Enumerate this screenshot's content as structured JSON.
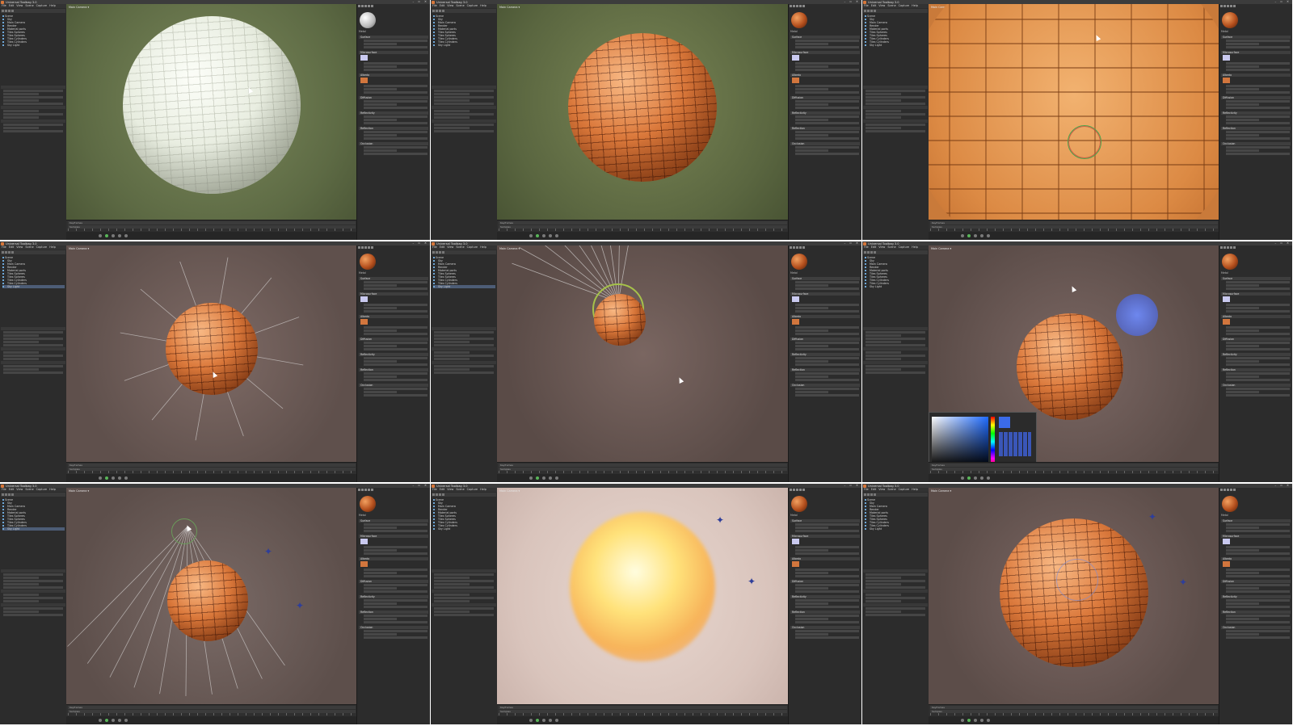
{
  "app": {
    "window_title": "Universal Toolbag 3.0",
    "menu": [
      "File",
      "Edit",
      "View",
      "Scene",
      "Capture",
      "Help"
    ],
    "viewport_label": "Main Camera ▾",
    "window_controls": "– ▫ ✕"
  },
  "scene_tree": [
    "Scene",
    "Sky",
    "Main Camera",
    "Render",
    "Material ports",
    "Tiles Spheres",
    "Tiles Spheres",
    "Tiles Cylinders",
    "Tiles Cylinders",
    "Sky Light"
  ],
  "material": {
    "name": "Metal",
    "sections": [
      "Surface",
      "Microsurface",
      "Albedo",
      "Diffusion",
      "Reflectivity",
      "Reflection",
      "Occlusion"
    ]
  },
  "timeline": {
    "row_labels": [
      "Keyframes",
      "Samples"
    ]
  },
  "colors": {
    "bg_dark": "#2a2a2a",
    "panel": "#2c2c2c",
    "accent_orange": "#d2763d",
    "select_blue": "#4d5d76"
  },
  "tiles": [
    {
      "kind": "white-sphere"
    },
    {
      "kind": "orange-sphere"
    },
    {
      "kind": "closeup"
    },
    {
      "kind": "light-rays"
    },
    {
      "kind": "spot-gizmo"
    },
    {
      "kind": "color-picker"
    },
    {
      "kind": "spot-top"
    },
    {
      "kind": "glow"
    },
    {
      "kind": "final"
    }
  ]
}
